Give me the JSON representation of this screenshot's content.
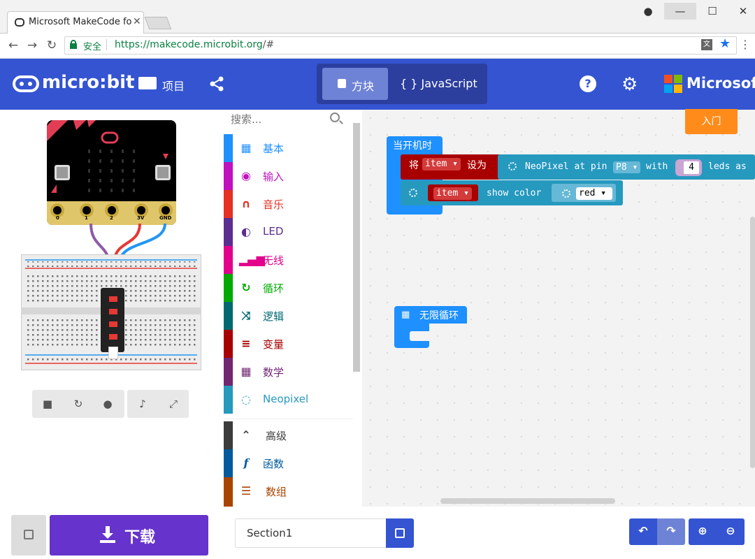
{
  "browser": {
    "tab_title": "Microsoft MakeCode fo",
    "secure_label": "安全",
    "url_scheme": "https://",
    "url_host": "makecode.microbit.org",
    "url_path": "/#"
  },
  "header": {
    "logo_text": "micro:bit",
    "projects_label": "项目",
    "blocks_tab_label": "方块",
    "js_tab_label": "{ } JavaScript",
    "ms_text": "Microsoft",
    "brand_color": "#3454d1"
  },
  "simulator": {
    "pins": [
      "0",
      "1",
      "2",
      "3V",
      "GND"
    ],
    "controls": [
      "stop-icon",
      "restart-icon",
      "slowmo-icon",
      "mute-icon",
      "fullscreen-icon"
    ]
  },
  "toolbox": {
    "search_placeholder": "搜索...",
    "categories": [
      {
        "label": "基本",
        "color": "#1e90ff",
        "icon": "grid-icon"
      },
      {
        "label": "输入",
        "color": "#c010c0",
        "icon": "input-icon"
      },
      {
        "label": "音乐",
        "color": "#e63022",
        "icon": "headphones-icon"
      },
      {
        "label": "LED",
        "color": "#5c2d91",
        "icon": "toggle-icon"
      },
      {
        "label": "无线",
        "color": "#e3008c",
        "icon": "signal-icon"
      },
      {
        "label": "循环",
        "color": "#00aa00",
        "icon": "loop-icon"
      },
      {
        "label": "逻辑",
        "color": "#006970",
        "icon": "shuffle-icon"
      },
      {
        "label": "变量",
        "color": "#a80000",
        "icon": "lines-icon"
      },
      {
        "label": "数学",
        "color": "#712672",
        "icon": "calculator-icon"
      },
      {
        "label": "Neopixel",
        "color": "#2699bf",
        "icon": "neopixel-icon"
      }
    ],
    "advanced": [
      {
        "label": "高级",
        "color": "#3c3c3c",
        "icon": "chevron-up-icon"
      },
      {
        "label": "函数",
        "color": "#005a9e",
        "icon": "function-icon"
      },
      {
        "label": "数组",
        "color": "#a94400",
        "icon": "list-icon"
      }
    ]
  },
  "workspace": {
    "getting_started": "入门",
    "on_start_label": "当开机时",
    "set_label": "将",
    "set_var": "item",
    "set_to": "设为",
    "neopixel_text": "NeoPixel at pin",
    "pin_value": "P8",
    "with_label": "with",
    "leds_value": "4",
    "leds_as": "leds as",
    "show_var": "item",
    "show_color_label": "show color",
    "color_value": "red",
    "forever_label": "无限循环"
  },
  "bottom": {
    "download_label": "下载",
    "project_name": "Section1"
  }
}
